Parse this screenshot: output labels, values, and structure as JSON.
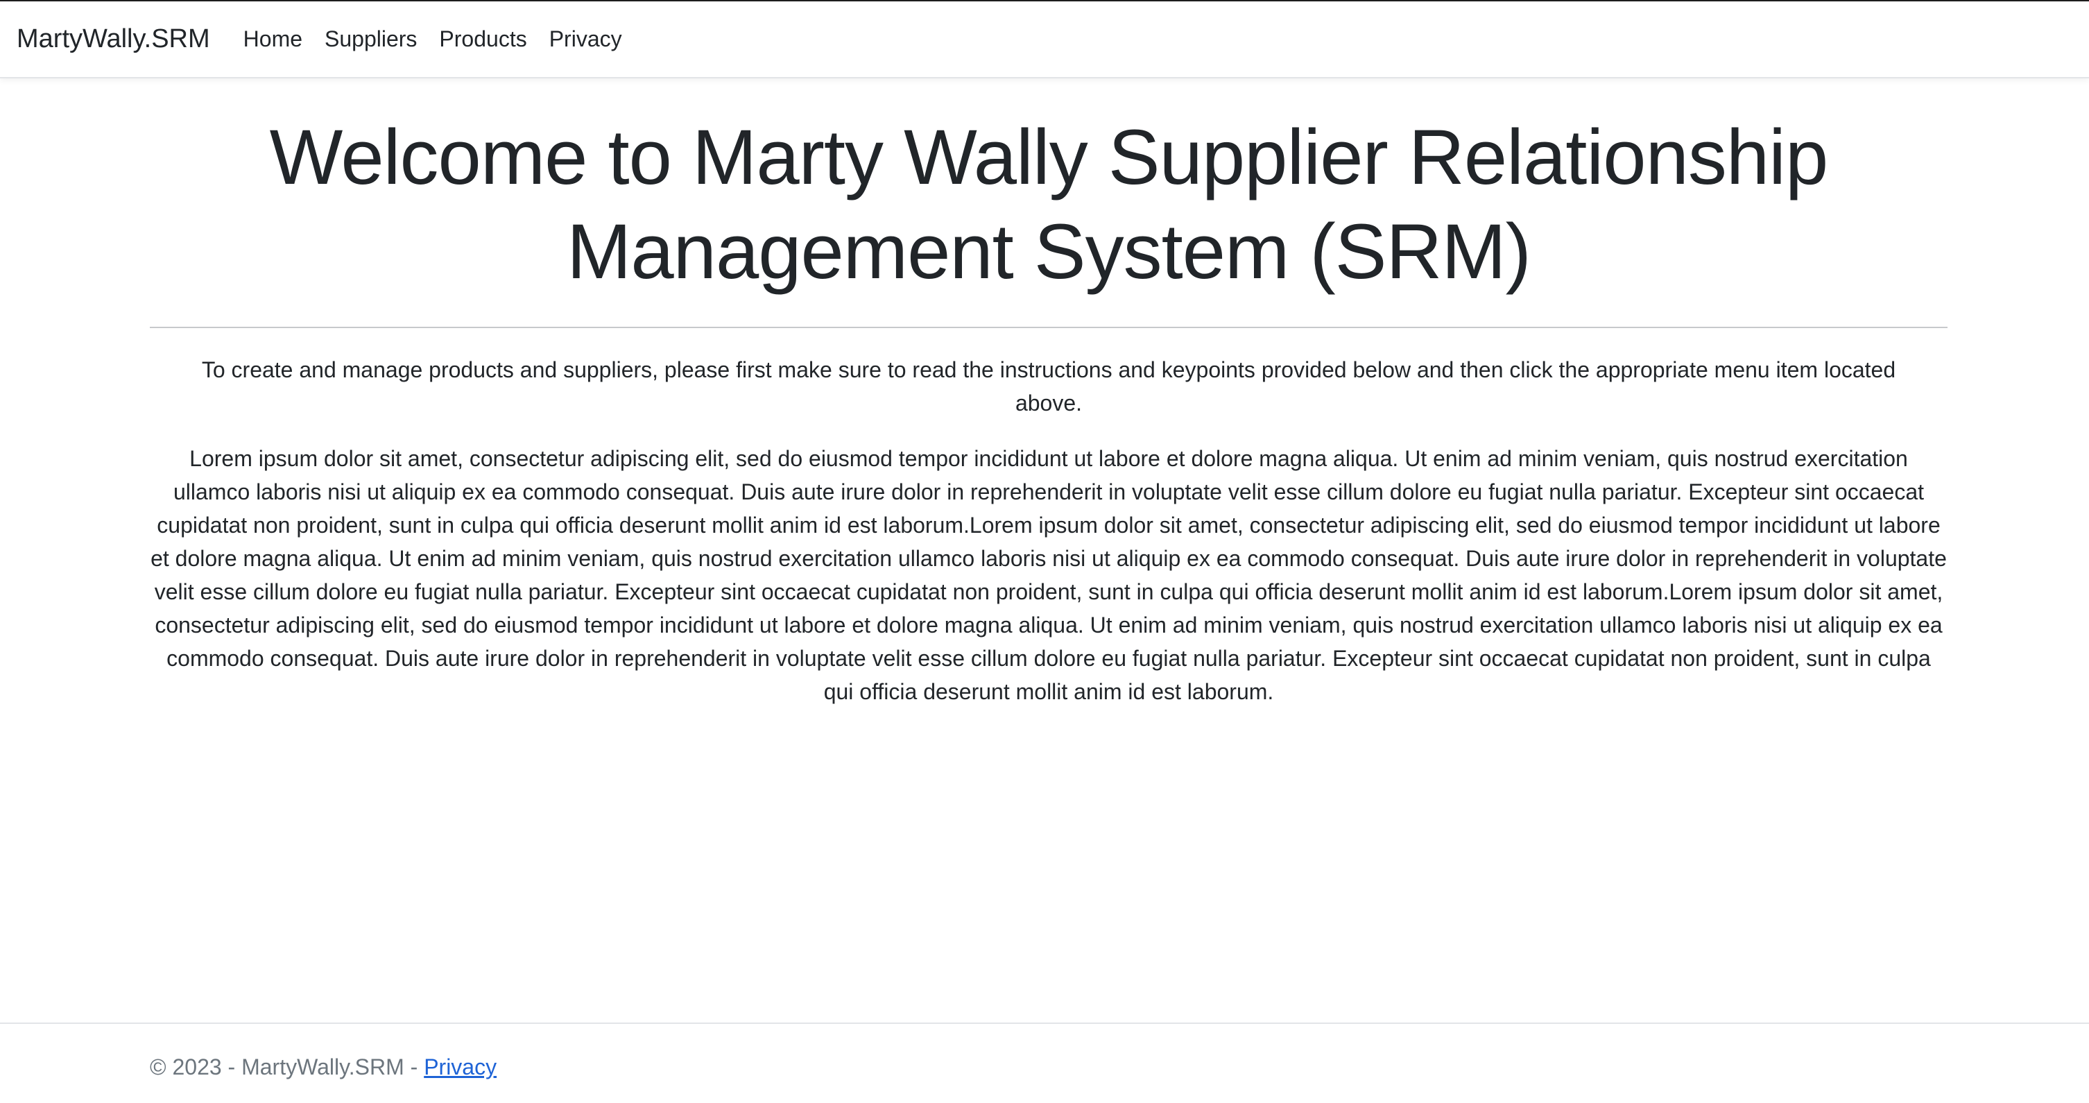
{
  "navbar": {
    "brand": "MartyWally.SRM",
    "links": [
      {
        "label": "Home"
      },
      {
        "label": "Suppliers"
      },
      {
        "label": "Products"
      },
      {
        "label": "Privacy"
      }
    ]
  },
  "main": {
    "title": "Welcome to Marty Wally Supplier Relationship Management System (SRM)",
    "intro": "To create and manage products and suppliers, please first make sure to read the instructions and keypoints provided below and then click the appropriate menu item located above.",
    "body": "Lorem ipsum dolor sit amet, consectetur adipiscing elit, sed do eiusmod tempor incididunt ut labore et dolore magna aliqua. Ut enim ad minim veniam, quis nostrud exercitation ullamco laboris nisi ut aliquip ex ea commodo consequat. Duis aute irure dolor in reprehenderit in voluptate velit esse cillum dolore eu fugiat nulla pariatur. Excepteur sint occaecat cupidatat non proident, sunt in culpa qui officia deserunt mollit anim id est laborum.Lorem ipsum dolor sit amet, consectetur adipiscing elit, sed do eiusmod tempor incididunt ut labore et dolore magna aliqua. Ut enim ad minim veniam, quis nostrud exercitation ullamco laboris nisi ut aliquip ex ea commodo consequat. Duis aute irure dolor in reprehenderit in voluptate velit esse cillum dolore eu fugiat nulla pariatur. Excepteur sint occaecat cupidatat non proident, sunt in culpa qui officia deserunt mollit anim id est laborum.Lorem ipsum dolor sit amet, consectetur adipiscing elit, sed do eiusmod tempor incididunt ut labore et dolore magna aliqua. Ut enim ad minim veniam, quis nostrud exercitation ullamco laboris nisi ut aliquip ex ea commodo consequat. Duis aute irure dolor in reprehenderit in voluptate velit esse cillum dolore eu fugiat nulla pariatur. Excepteur sint occaecat cupidatat non proident, sunt in culpa qui officia deserunt mollit anim id est laborum."
  },
  "footer": {
    "copyright": "© 2023 - MartyWally.SRM - ",
    "privacy_link": "Privacy"
  },
  "colors": {
    "text": "#212529",
    "muted": "#6c757d",
    "link": "#1e63d6",
    "border": "#e3e5e8"
  }
}
